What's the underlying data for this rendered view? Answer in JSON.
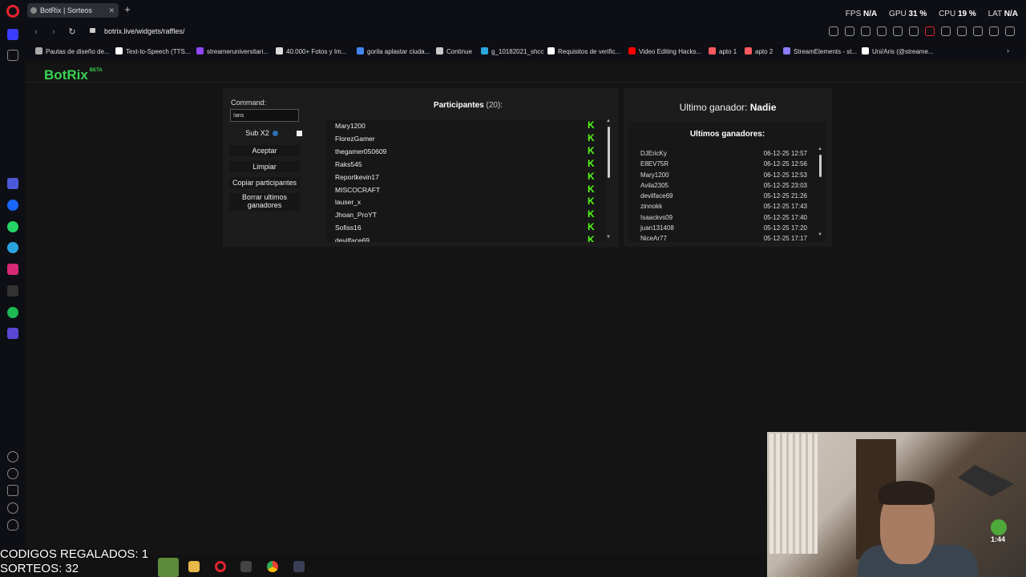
{
  "browser": {
    "tab_title": "BotRix | Sorteos",
    "new_tab": "+",
    "url": "botrix.live/widgets/raffles/",
    "stats": {
      "fps_label": "FPS",
      "fps_value": "N/A",
      "gpu_label": "GPU",
      "gpu_value": "31 %",
      "cpu_label": "CPU",
      "cpu_value": "19 %",
      "lat_label": "LAT",
      "lat_value": "N/A"
    },
    "bookmarks": [
      {
        "label": "Pautas de diseño de...",
        "color": "#aaaaaa"
      },
      {
        "label": "Text-to-Speech (TTS...",
        "color": "#ffffff"
      },
      {
        "label": "streameruniversitari...",
        "color": "#9146ff"
      },
      {
        "label": "40.000+ Fotos y Im...",
        "color": "#dddddd"
      },
      {
        "label": "gorila aplastar ciuda...",
        "color": "#4285f4"
      },
      {
        "label": "Continue",
        "color": "#cccccc"
      },
      {
        "label": "g_10182021_shcc",
        "color": "#2aa7e0"
      },
      {
        "label": "Requisitos de verific...",
        "color": "#ffffff"
      },
      {
        "label": "Video Editing Hacks...",
        "color": "#ff0000"
      },
      {
        "label": "apto 1",
        "color": "#ff5a5f"
      },
      {
        "label": "apto 2",
        "color": "#ff5a5f"
      },
      {
        "label": "StreamElements - st...",
        "color": "#8a7bff"
      },
      {
        "label": "Uni/Aris (@streame...",
        "color": "#ffffff"
      }
    ]
  },
  "app": {
    "logo": "BotRix",
    "logo_badge": "BETA"
  },
  "controls": {
    "command_label": "Command:",
    "command_value": "!aris",
    "sub_label": "Sub X2",
    "accept": "Aceptar",
    "clear": "Limpiar",
    "copy": "Copiar participantes",
    "delete_line1": "Borrar ultimos",
    "delete_line2": "ganadores"
  },
  "participants": {
    "title": "Participantes",
    "count": "(20):",
    "items": [
      "Mary1200",
      "FlorezGamer",
      "thegamer050609",
      "Raks545",
      "Reportkevin17",
      "MISCOCRAFT",
      "lauser_x",
      "Jhoan_ProYT",
      "Sofiss16",
      "devilface69"
    ],
    "platform_icon": "K"
  },
  "winners": {
    "last_label": "Ultimo ganador:",
    "last_value": "Nadie",
    "list_title": "Ultimos ganadores:",
    "items": [
      {
        "name": "DJEricKy",
        "date": "06-12-25 12:57"
      },
      {
        "name": "E8EV75R",
        "date": "06-12-25 12:56"
      },
      {
        "name": "Mary1200",
        "date": "06-12-25 12:53"
      },
      {
        "name": "Avila2305",
        "date": "05-12-25 23:03"
      },
      {
        "name": "devilface69",
        "date": "05-12-25 21:26"
      },
      {
        "name": "zinnokk",
        "date": "05-12-25 17:43"
      },
      {
        "name": "Isaackvs09",
        "date": "05-12-25 17:40"
      },
      {
        "name": "juan131408",
        "date": "05-12-25 17:20"
      },
      {
        "name": "NiceAr77",
        "date": "05-12-25 17:17"
      }
    ]
  },
  "overlay": {
    "line1": "CODIGOS REGALADOS: 1",
    "line2": "SORTEOS: 32",
    "webcam_badge": "1:44"
  }
}
